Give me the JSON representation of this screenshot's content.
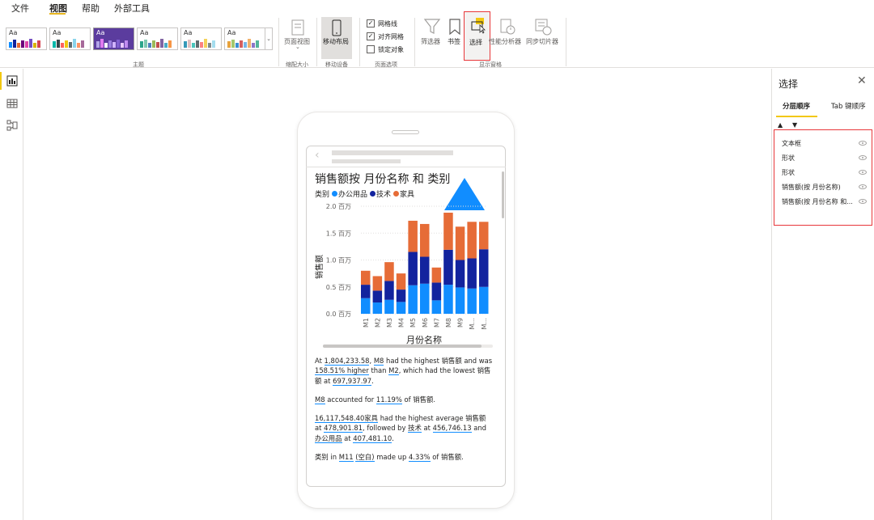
{
  "menu": {
    "file": "文件",
    "view": "视图",
    "help": "帮助",
    "external_tools": "外部工具"
  },
  "ribbon": {
    "themes_group_label": "主题",
    "fit_group_label": "缩配大小",
    "mobile_group_label": "移动设备",
    "page_options_label": "页面选项",
    "show_pane_label": "显示窗格",
    "page_view": "页面视图",
    "mobile_layout": "移动布局",
    "gridlines": "网格线",
    "snap_to_grid": "对齐网格",
    "lock_objects": "锁定对象",
    "filters": "筛选器",
    "bookmarks": "书签",
    "selection": "选择",
    "performance_analyzer": "性能分析器",
    "sync_slicers": "同步切片器",
    "theme_aa": "Aa",
    "accent_color": "#f2c811",
    "highlight_color": "#e8373a"
  },
  "visual": {
    "title": "销售额按 月份名称 和 类别",
    "legend_title": "类别",
    "xlabel": "月份名称",
    "ylabel": "销售额"
  },
  "chart_data": {
    "type": "bar",
    "stacked": true,
    "title": "销售额按 月份名称 和 类别",
    "xlabel": "月份名称",
    "ylabel": "销售额",
    "ylim": [
      0,
      2.0
    ],
    "y_unit": "百万",
    "yticks": [
      "0.0 百万",
      "0.5 百万",
      "1.0 百万",
      "1.5 百万",
      "2.0 百万"
    ],
    "categories": [
      "M1",
      "M2",
      "M3",
      "M4",
      "M5",
      "M6",
      "M7",
      "M8",
      "M9",
      "M...",
      "M..."
    ],
    "series": [
      {
        "name": "办公用品",
        "color": "#118dff",
        "values": [
          0.29,
          0.21,
          0.26,
          0.22,
          0.53,
          0.56,
          0.25,
          0.54,
          0.49,
          0.47,
          0.5
        ]
      },
      {
        "name": "技术",
        "color": "#12239e",
        "values": [
          0.25,
          0.22,
          0.35,
          0.23,
          0.62,
          0.5,
          0.33,
          0.65,
          0.51,
          0.56,
          0.7
        ]
      },
      {
        "name": "家具",
        "color": "#e66c37",
        "values": [
          0.26,
          0.27,
          0.35,
          0.3,
          0.58,
          0.61,
          0.28,
          0.69,
          0.62,
          0.68,
          0.51
        ]
      }
    ],
    "grid": true,
    "legend_position": "top-left"
  },
  "narrative": {
    "p1": [
      "At ",
      "1,804,233.58",
      ", ",
      "M8",
      " had the highest 销售额 and was ",
      "158.51% higher",
      " than ",
      "M2",
      ", which had the lowest 销售额 at ",
      "697,937.97",
      "."
    ],
    "p2": [
      "M8",
      " accounted for ",
      "11.19%",
      " of 销售额."
    ],
    "p3": [
      "16,117,548.40",
      "家具",
      " had the highest average 销售额 at ",
      "478,901.81",
      ", followed by ",
      "技术",
      " at ",
      "456,746.13",
      " and ",
      "办公用品",
      " at ",
      "407,481.10",
      "."
    ],
    "p4": [
      "类别 in ",
      "M11",
      " ",
      "(空白)",
      " made up ",
      "4.33%",
      " of 销售额."
    ]
  },
  "selection_pane": {
    "title": "选择",
    "tab_layer_order": "分层顺序",
    "tab_tab_order": "Tab 键顺序",
    "layers": [
      "文本框",
      "形状",
      "形状",
      "销售额(按 月份名称)",
      "销售额(按 月份名称 和..."
    ]
  }
}
